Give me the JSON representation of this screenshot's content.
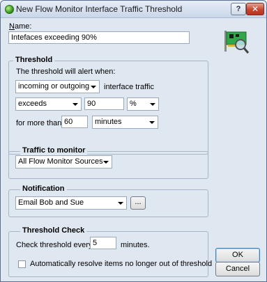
{
  "window": {
    "title": "New Flow Monitor Interface Traffic Threshold",
    "help_label": "?",
    "close_label": "✕"
  },
  "name": {
    "label": "Name:",
    "value": "Intefaces exceeding 90%"
  },
  "threshold": {
    "title": "Threshold",
    "alert_text": "The threshold will alert when:",
    "direction_value": "incoming or outgoing",
    "interface_traffic_text": "interface traffic",
    "comparison_value": "exceeds",
    "amount_value": "90",
    "unit_value": "%",
    "for_more_than_text": "for more than",
    "duration_value": "60",
    "duration_unit_value": "minutes"
  },
  "traffic": {
    "title": "Traffic to monitor",
    "source_value": "All Flow Monitor Sources"
  },
  "notification": {
    "title": "Notification",
    "value": "Email Bob and Sue",
    "browse_label": "..."
  },
  "threshold_check": {
    "title": "Threshold Check",
    "check_text": "Check threshold every",
    "interval_value": "5",
    "minutes_text": "minutes.",
    "auto_resolve_label": "Automatically resolve items no longer out of threshold",
    "auto_resolve_checked": false
  },
  "buttons": {
    "ok_label": "OK",
    "cancel_label": "Cancel"
  },
  "icons": {
    "app": "flow-monitor-icon",
    "header": "network-card-magnifier-icon"
  },
  "colors": {
    "titlebar": "#c9d7e9",
    "dialog_bg": "#dfe7f1",
    "close_button": "#c7452e"
  }
}
